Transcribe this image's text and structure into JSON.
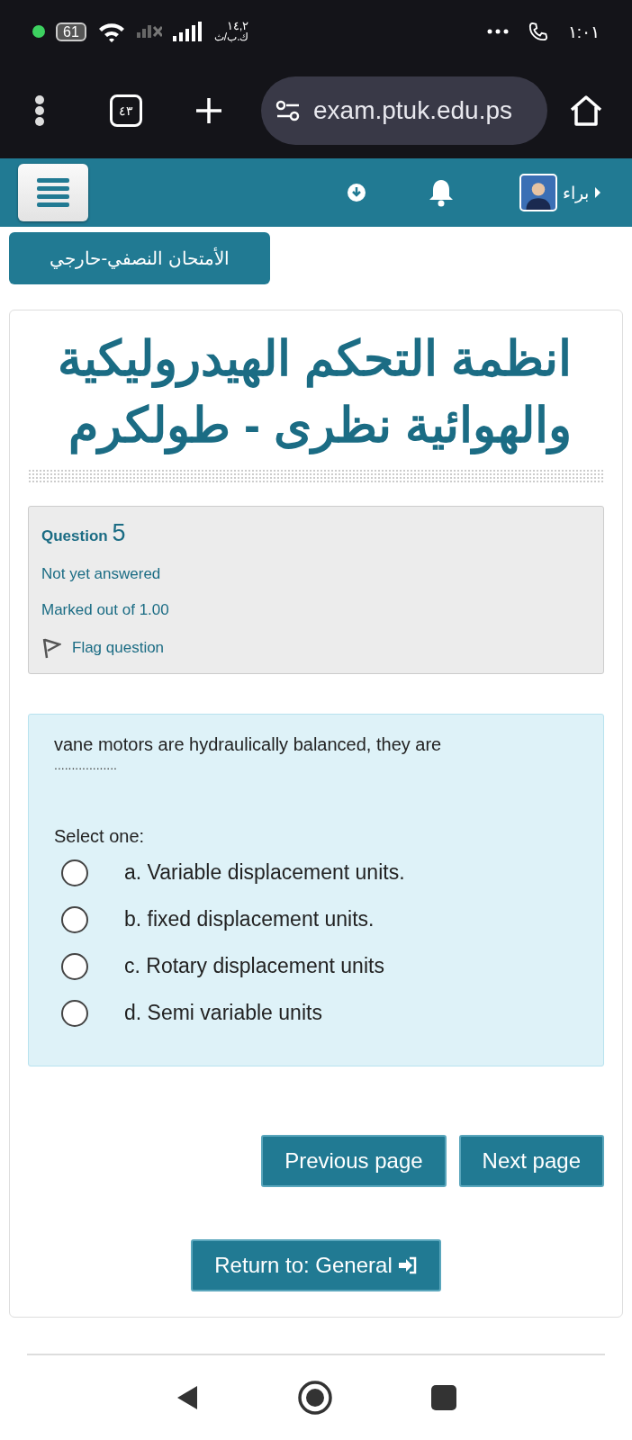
{
  "status_bar": {
    "battery": "61",
    "speed_value": "١٤,٢",
    "speed_unit": "ك.ب/ث",
    "time": "١:٠١"
  },
  "browser": {
    "tab_count": "٤٣",
    "url": "exam.ptuk.edu.ps"
  },
  "navbar": {
    "user_name": "براء"
  },
  "breadcrumb": {
    "label": "الأمتحان النصفي-حارجي"
  },
  "course_title": "انظمة التحكم الهيدروليكية والهوائية نظرى - طولكرم",
  "question_info": {
    "label": "Question",
    "number": "5",
    "state": "Not yet answered",
    "marks": "Marked out of 1.00",
    "flag": {
      "label": "Flag question",
      "flagged": false
    }
  },
  "question": {
    "text": "vane motors are hydraulically balanced, they are",
    "blank": "..................",
    "prompt": "Select one:",
    "options": [
      {
        "label": "a. Variable displacement units.",
        "selected": false
      },
      {
        "label": "b. fixed displacement units.",
        "selected": false
      },
      {
        "label": "c. Rotary displacement units",
        "selected": false
      },
      {
        "label": "d. Semi variable units",
        "selected": false
      }
    ]
  },
  "navigation": {
    "previous": "Previous page",
    "next": "Next page",
    "return": "Return to: General"
  }
}
